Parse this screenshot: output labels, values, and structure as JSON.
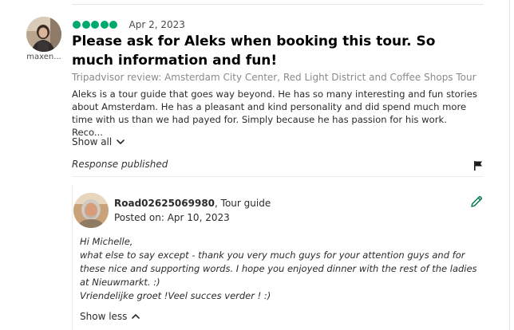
{
  "review": {
    "reviewer_name": "maxen...",
    "rating": 5,
    "date": "Apr 2, 2023",
    "title": "Please ask for Aleks when booking this tour. So much information and fun!",
    "source": "Tripadvisor review: Amsterdam City Center, Red Light District and Coffee Shops Tour",
    "body": "Aleks is a tour guide that goes way beyond. He has so many interesting and fun stories about Amsterdam. He has a pleasant and kind personality and did spend much more time with us than we had payed for. Simply because he has passion for his work. Reco...",
    "show_all_label": "Show all",
    "response_status": "Response published"
  },
  "response": {
    "owner_name": "Road02625069980",
    "owner_role": ", Tour guide",
    "posted_label": "Posted on: Apr 10, 2023",
    "greeting": "Hi Michelle,",
    "line1": "what else to say except - thank you very much guys for your attention guys and for these nice and supporting words. I hope you enjoyed dinner with the rest of the ladies at Nieuwmarkt. :)",
    "line2": "Vriendelijke groet !Veel succes verder ! :)",
    "show_less_label": "Show less"
  },
  "icons": {
    "flag": "flag-icon",
    "edit": "pencil-icon",
    "chevron_down": "chevron-down-icon",
    "chevron_up": "chevron-up-icon"
  },
  "colors": {
    "rating_green": "#00aa6c",
    "edit_green": "#0a7a54"
  }
}
